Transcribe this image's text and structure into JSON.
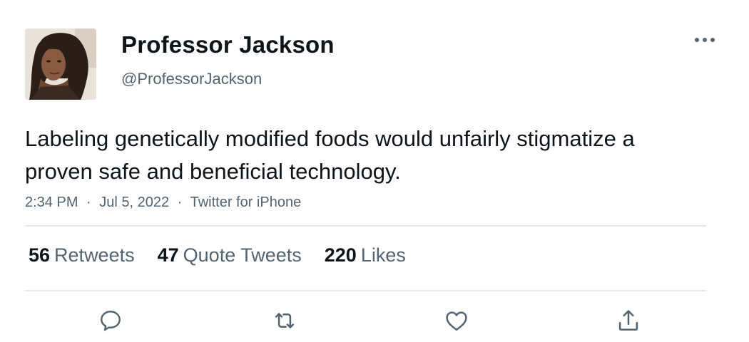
{
  "tweet": {
    "author": {
      "display_name": "Professor Jackson",
      "handle": "@ProfessorJackson"
    },
    "text": "Labeling genetically modified foods would unfairly stigmatize a proven safe and beneficial technology.",
    "meta": {
      "time": "2:34 PM",
      "date": "Jul 5, 2022",
      "source": "Twitter for iPhone",
      "separator": "·"
    },
    "stats": {
      "retweets": {
        "count": "56",
        "label": "Retweets"
      },
      "quote_tweets": {
        "count": "47",
        "label": "Quote Tweets"
      },
      "likes": {
        "count": "220",
        "label": "Likes"
      }
    }
  },
  "icons": {
    "more": "more-horizontal-icon",
    "reply": "reply-icon",
    "retweet": "retweet-icon",
    "like": "heart-icon",
    "share": "share-icon"
  },
  "colors": {
    "text": "#0f1419",
    "secondary": "#536471",
    "divider": "#e4e8eb",
    "icon": "#536471"
  }
}
